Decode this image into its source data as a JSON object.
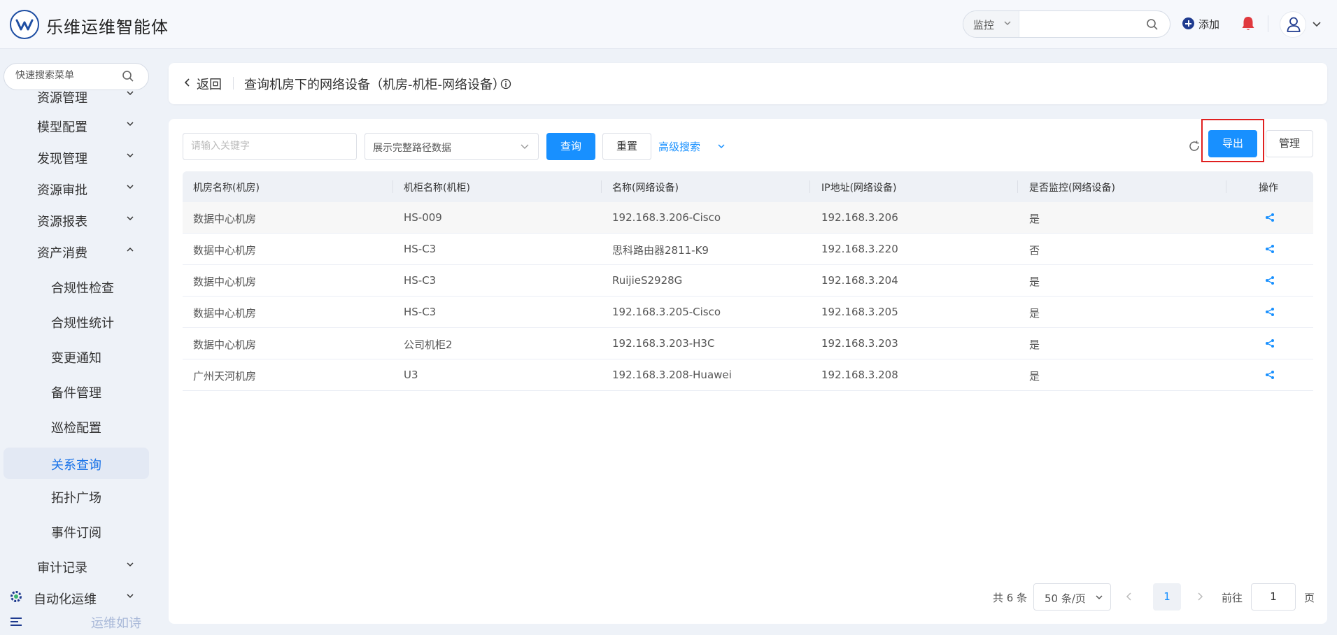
{
  "header": {
    "brand": "乐维运维智能体",
    "search_type": "监控",
    "add_label": "添加"
  },
  "sidebar": {
    "search_placeholder": "快速搜索菜单",
    "items": [
      {
        "label": "资源管理",
        "has_chevron": true
      },
      {
        "label": "模型配置",
        "has_chevron": true
      },
      {
        "label": "发现管理",
        "has_chevron": true
      },
      {
        "label": "资源审批",
        "has_chevron": true
      },
      {
        "label": "资源报表",
        "has_chevron": true
      },
      {
        "label": "资产消费",
        "has_chevron": true,
        "expanded": true
      },
      {
        "label": "合规性检查"
      },
      {
        "label": "合规性统计"
      },
      {
        "label": "变更通知"
      },
      {
        "label": "备件管理"
      },
      {
        "label": "巡检配置"
      },
      {
        "label": "关系查询",
        "active": true
      },
      {
        "label": "拓扑广场"
      },
      {
        "label": "事件订阅"
      },
      {
        "label": "审计记录",
        "has_chevron": true
      },
      {
        "label": "自动化运维",
        "has_chevron": true
      }
    ],
    "footer_text": "运维如诗"
  },
  "title_bar": {
    "back_label": "返回",
    "title": "查询机房下的网络设备（机房-机柜-网络设备）"
  },
  "toolbar": {
    "keyword_placeholder": "请输入关键字",
    "path_select_value": "展示完整路径数据",
    "query_label": "查询",
    "reset_label": "重置",
    "advanced_label": "高级搜索",
    "export_label": "导出",
    "manage_label": "管理"
  },
  "table": {
    "columns": [
      "机房名称(机房)",
      "机柜名称(机柜)",
      "名称(网络设备)",
      "IP地址(网络设备)",
      "是否监控(网络设备)",
      "操作"
    ],
    "rows": [
      [
        "数据中心机房",
        "HS-009",
        "192.168.3.206-Cisco",
        "192.168.3.206",
        "是"
      ],
      [
        "数据中心机房",
        "HS-C3",
        "思科路由器2811-K9",
        "192.168.3.220",
        "否"
      ],
      [
        "数据中心机房",
        "HS-C3",
        "RuijieS2928G",
        "192.168.3.204",
        "是"
      ],
      [
        "数据中心机房",
        "HS-C3",
        "192.168.3.205-Cisco",
        "192.168.3.205",
        "是"
      ],
      [
        "数据中心机房",
        "公司机柜2",
        "192.168.3.203-H3C",
        "192.168.3.203",
        "是"
      ],
      [
        "广州天河机房",
        "U3",
        "192.168.3.208-Huawei",
        "192.168.3.208",
        "是"
      ]
    ]
  },
  "pagination": {
    "total": "共 6 条",
    "page_size": "50 条/页",
    "current_page": "1",
    "goto_label": "前往",
    "goto_value": "1",
    "page_unit": "页"
  },
  "colors": {
    "primary": "#1890ff",
    "highlight_border": "#e02020",
    "active_menu_text": "#1a73e8",
    "bell": "#e0393e"
  }
}
